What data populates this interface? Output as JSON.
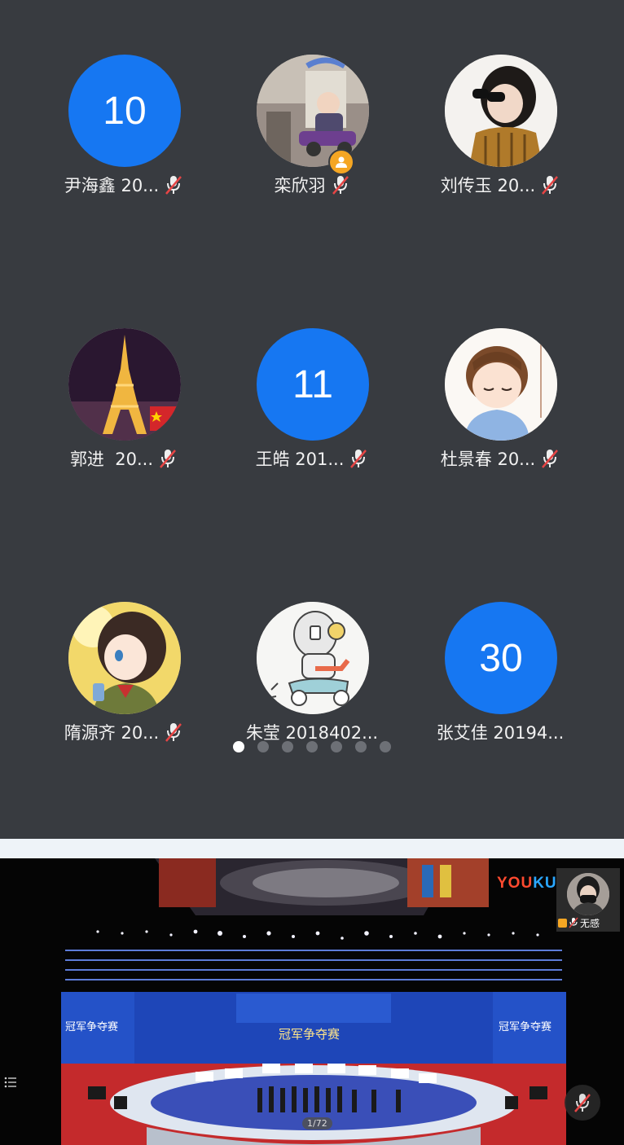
{
  "participants": [
    {
      "label": "尹海鑫 20...",
      "avatar_type": "number",
      "avatar_text": "10",
      "mic": "muted-icon"
    },
    {
      "label": "栾欣羽",
      "avatar_type": "photo",
      "photo": "baby-in-toy-car",
      "host": true,
      "mic": "muted-icon"
    },
    {
      "label": "刘传玉 20...",
      "avatar_type": "photo",
      "photo": "girl-with-sunglasses",
      "mic": "muted-icon"
    },
    {
      "label": "郭进  20...",
      "avatar_type": "photo",
      "photo": "eiffel-tower-night",
      "mic": "muted-icon"
    },
    {
      "label": "王皓 201...",
      "avatar_type": "number",
      "avatar_text": "11",
      "mic": "muted-icon"
    },
    {
      "label": "杜景春 20...",
      "avatar_type": "photo",
      "photo": "cartoon-boy",
      "mic": "muted-icon"
    },
    {
      "label": "隋源齐 20...",
      "avatar_type": "photo",
      "photo": "anime-girl",
      "mic": "muted-icon"
    },
    {
      "label": "朱莹 2018402...",
      "avatar_type": "photo",
      "photo": "robot-on-scooter",
      "mic": null
    },
    {
      "label": "张艾佳 20194...",
      "avatar_type": "number",
      "avatar_text": "30",
      "mic": null
    }
  ],
  "pagination": {
    "total": 7,
    "current": 1
  },
  "video": {
    "watermark_part1": "YOU",
    "watermark_part2": "KU",
    "banner_side_text": "冠军争夺赛",
    "banner_center_text": "冠军争夺赛",
    "page_counter": "1/72",
    "self_view_name": "无感"
  },
  "colors": {
    "panel_bg": "#383b40",
    "number_avatar": "#1677f2",
    "host_badge": "#f5a623",
    "muted_slash": "#e64545"
  }
}
